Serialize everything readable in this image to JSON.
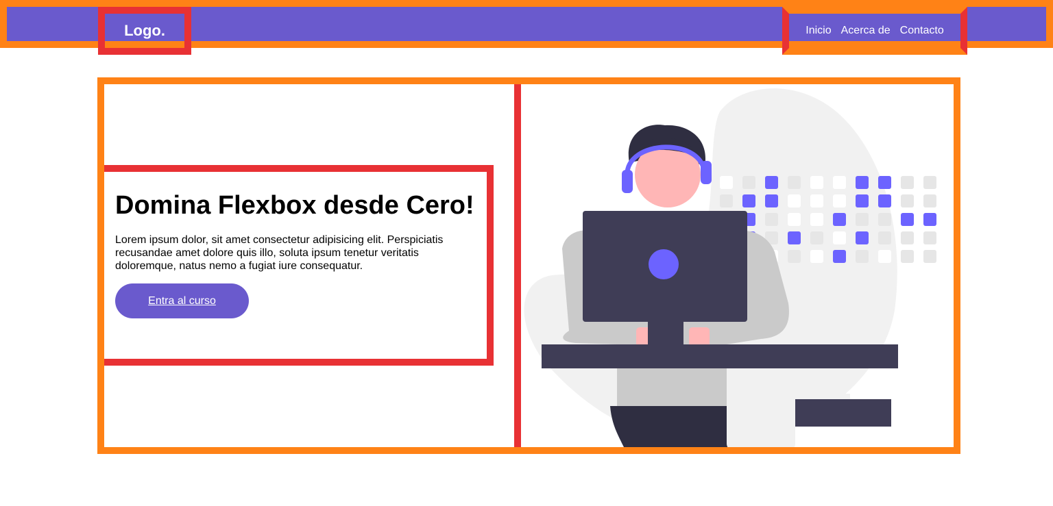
{
  "header": {
    "logo": "Logo.",
    "nav": [
      "Inicio",
      "Acerca de",
      "Contacto"
    ]
  },
  "hero": {
    "title": "Domina Flexbox desde Cero!",
    "description": "Lorem ipsum dolor, sit amet consectetur adipisicing elit. Perspiciatis recusandae amet dolore quis illo, soluta ipsum tenetur veritatis doloremque, natus nemo a fugiat iure consequatur.",
    "cta": "Entra al curso"
  },
  "colors": {
    "brand": "#6a5acd",
    "outline_outer": "#ff8216",
    "outline_inner": "#e83134",
    "illustration_accent": "#6c63ff",
    "illustration_dark": "#3f3d56"
  }
}
